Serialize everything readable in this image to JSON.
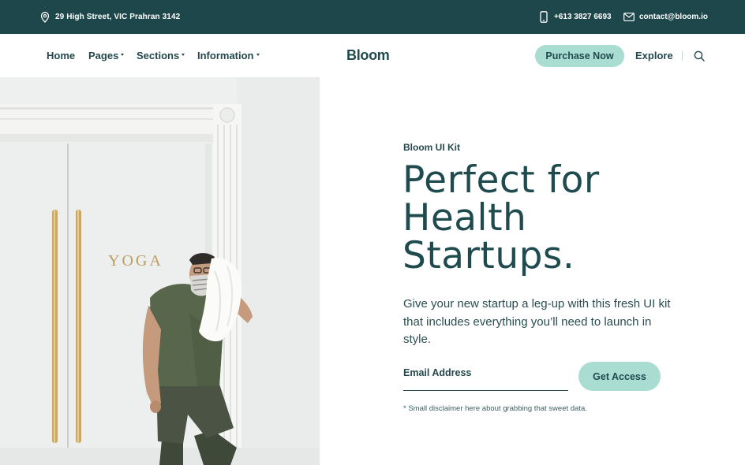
{
  "topbar": {
    "address": "29 High Street, VIC Prahran 3142",
    "phone": "+613 3827 6693",
    "email": "contact@bloom.io",
    "icons": {
      "address": "map-pin-icon",
      "phone": "phone-icon",
      "email": "mail-icon"
    }
  },
  "nav": {
    "items": [
      {
        "label": "Home",
        "has_dropdown": false
      },
      {
        "label": "Pages",
        "has_dropdown": true
      },
      {
        "label": "Sections",
        "has_dropdown": true
      },
      {
        "label": "Information",
        "has_dropdown": true
      }
    ],
    "logo": "Bloom",
    "purchase_label": "Purchase Now",
    "explore_label": "Explore",
    "search_icon": "search-icon"
  },
  "hero": {
    "image_sign_text": "YOGA",
    "eyebrow": "Bloom UI Kit",
    "headline_lines": [
      "Perfect for",
      "Health",
      "Startups."
    ],
    "subtitle": "Give your new startup a leg-up with this fresh UI kit that includes everything you’ll need to launch in style.",
    "email_label": "Email Address",
    "cta_label": "Get Access",
    "disclaimer": "* Small disclaimer here about grabbing that sweet data."
  },
  "colors": {
    "topbar_bg": "#1d474b",
    "primary_text": "#1f4a4e",
    "accent_mint": "#a9ddd2",
    "image_wall": "#eef0ef",
    "brass": "#c9a767",
    "shirt": "#58664c"
  }
}
